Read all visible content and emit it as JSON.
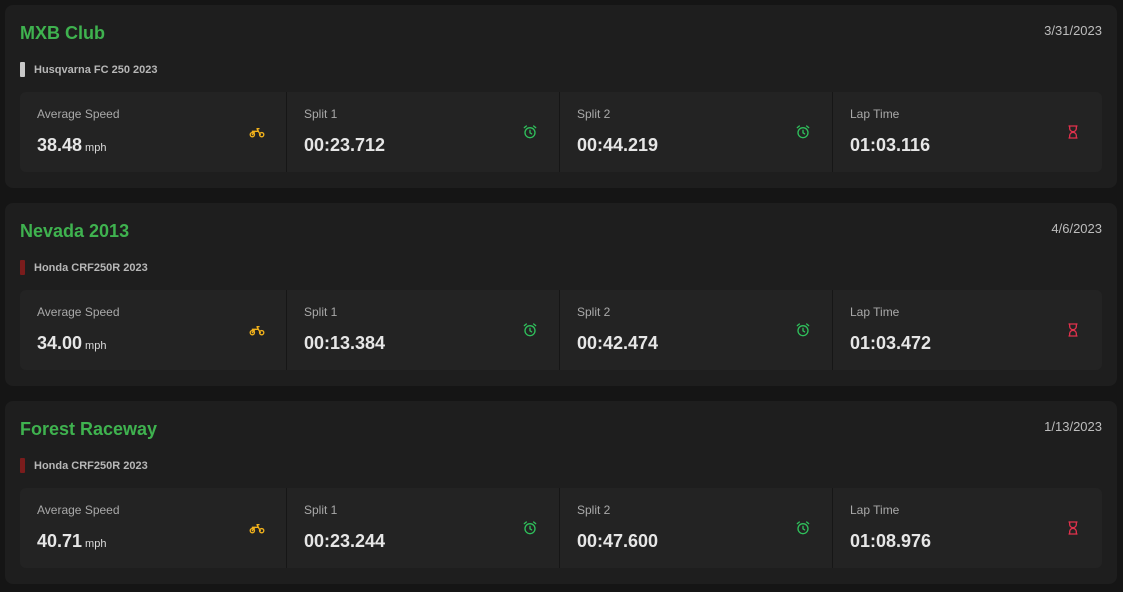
{
  "colors": {
    "title": "#3fb24f",
    "speed_icon": "#f2b21c",
    "split_icon": "#2fbf5b",
    "lap_icon": "#e0314c"
  },
  "sessions": [
    {
      "track": "MXB Club",
      "date": "3/31/2023",
      "bike": "Husqvarna FC 250 2023",
      "bike_color": "#c8c8c8",
      "stats": [
        {
          "label": "Average Speed",
          "value": "38.48",
          "unit": "mph",
          "icon": "motorcycle-icon"
        },
        {
          "label": "Split 1",
          "value": "00:23.712",
          "icon": "alarm-clock-icon"
        },
        {
          "label": "Split 2",
          "value": "00:44.219",
          "icon": "alarm-clock-icon"
        },
        {
          "label": "Lap Time",
          "value": "01:03.116",
          "icon": "hourglass-icon"
        }
      ]
    },
    {
      "track": "Nevada 2013",
      "date": "4/6/2023",
      "bike": "Honda CRF250R 2023",
      "bike_color": "#7a1c1c",
      "stats": [
        {
          "label": "Average Speed",
          "value": "34.00",
          "unit": "mph",
          "icon": "motorcycle-icon"
        },
        {
          "label": "Split 1",
          "value": "00:13.384",
          "icon": "alarm-clock-icon"
        },
        {
          "label": "Split 2",
          "value": "00:42.474",
          "icon": "alarm-clock-icon"
        },
        {
          "label": "Lap Time",
          "value": "01:03.472",
          "icon": "hourglass-icon"
        }
      ]
    },
    {
      "track": "Forest Raceway",
      "date": "1/13/2023",
      "bike": "Honda CRF250R 2023",
      "bike_color": "#7a1c1c",
      "stats": [
        {
          "label": "Average Speed",
          "value": "40.71",
          "unit": "mph",
          "icon": "motorcycle-icon"
        },
        {
          "label": "Split 1",
          "value": "00:23.244",
          "icon": "alarm-clock-icon"
        },
        {
          "label": "Split 2",
          "value": "00:47.600",
          "icon": "alarm-clock-icon"
        },
        {
          "label": "Lap Time",
          "value": "01:08.976",
          "icon": "hourglass-icon"
        }
      ]
    }
  ]
}
